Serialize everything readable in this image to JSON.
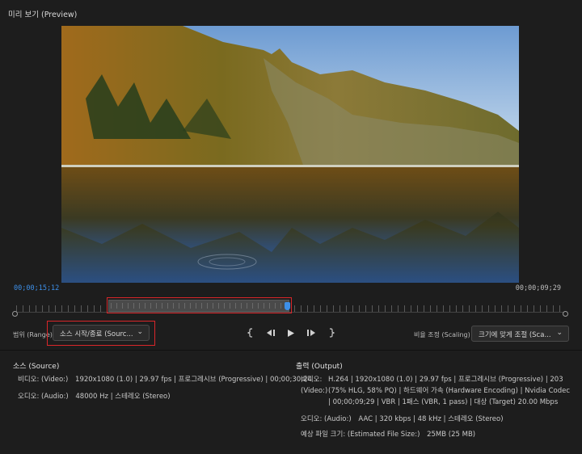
{
  "header": {
    "title": "미리 보기 (Preview)"
  },
  "timeline": {
    "current_time": "00;00;15;12",
    "duration": "00;00;09;29"
  },
  "controls": {
    "range_label": "범위 (Range)",
    "range_value": "소스 시작/종료 (Sourc...",
    "scale_label": "비율 조정 (Scaling)",
    "scale_value": "크기에 맞게 조절 (Sca...",
    "mark_in_icon": "mark-in-icon",
    "step_back_icon": "step-back-icon",
    "play_icon": "play-icon",
    "step_forward_icon": "step-forward-icon",
    "mark_out_icon": "mark-out-icon"
  },
  "source": {
    "title": "소스 (Source)",
    "video_key": "비디오: (Video:)",
    "video_val": "1920x1080 (1.0) | 29.97 fps | 프로그레시브 (Progressive) | 00;00;30;24",
    "audio_key": "오디오: (Audio:)",
    "audio_val": "48000 Hz | 스테레오 (Stereo)"
  },
  "output": {
    "title": "출력 (Output)",
    "video_key": "비디오: (Video:)",
    "video_val": "H.264 | 1920x1080 (1.0) | 29.97 fps | 프로그레시브 (Progressive) | 203 (75% HLG, 58% PQ) | 하드웨어 가속 (Hardware Encoding) | Nvidia Codec | 00;00;09;29 | VBR | 1패스 (VBR, 1 pass) | 대상 (Target) 20.00 Mbps",
    "audio_key": "오디오: (Audio:)",
    "audio_val": "AAC | 320 kbps | 48 kHz | 스테레오 (Stereo)",
    "size_key": "예상 파일 크기: (Estimated File Size:)",
    "size_val": "25MB (25 MB)"
  },
  "colors": {
    "accent": "#3d8fe8",
    "highlight": "#d9262a"
  }
}
